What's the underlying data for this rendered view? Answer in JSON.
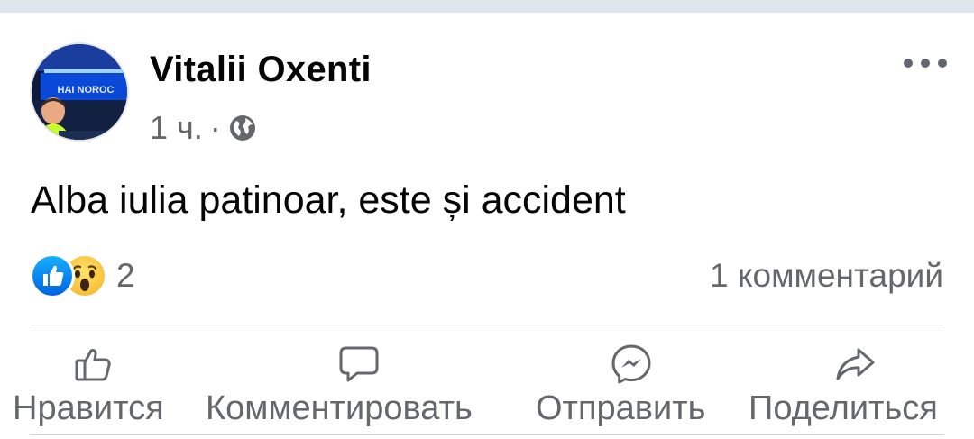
{
  "post": {
    "author": "Vitalii Oxenti",
    "time": "1 ч.",
    "separator": "·",
    "privacy_icon": "globe-icon",
    "text": "Alba iulia patinoar, este și accident",
    "avatar_sign_text": "HAI NOROC"
  },
  "reactions": {
    "icons": [
      "like-reaction-icon",
      "wow-reaction-icon"
    ],
    "count": "2"
  },
  "comments_count_label": "1 комментарий",
  "actions": {
    "like": "Нравится",
    "comment": "Комментировать",
    "send": "Отправить",
    "share": "Поделиться"
  },
  "colors": {
    "like_blue": "#1877f2",
    "secondary_text": "#65676b",
    "primary_text": "#050505",
    "top_strip": "#dfe5ed"
  }
}
